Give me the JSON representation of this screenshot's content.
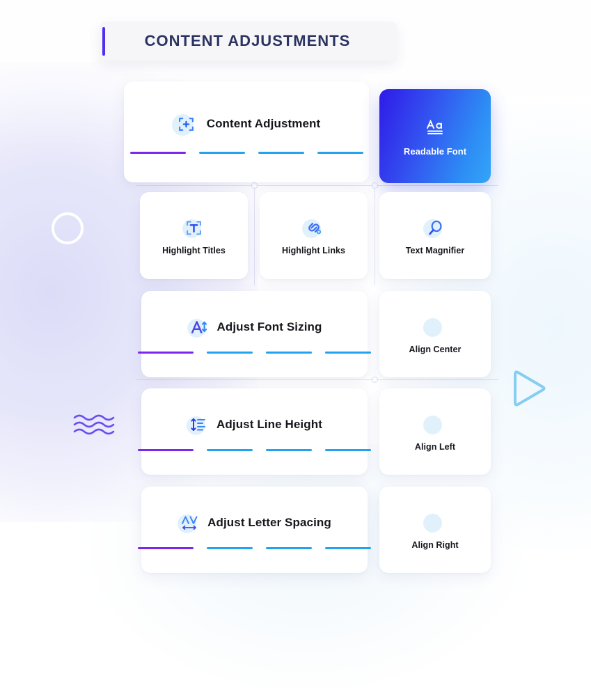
{
  "header": {
    "title": "CONTENT ADJUSTMENTS",
    "accent_color": "#4f2ef0",
    "background_color": "#f6f6f8"
  },
  "theme": {
    "accent_purple": "#7b27ee",
    "accent_blue": "#21a3ef",
    "active_gradient_from": "#2f1ae8",
    "active_gradient_to": "#34a5f8",
    "text_color": "#16161c",
    "title_color": "#2b3360",
    "card_background": "#ffffff",
    "page_background": "#ffffff",
    "lavender_glow": "#e6e6fa"
  },
  "panels": {
    "content_adjustment": {
      "label": "Content  Adjustment",
      "icon": "focus-frame-plus-icon",
      "bars": [
        {
          "state": "active",
          "color": "#7b27ee"
        },
        {
          "state": "inactive",
          "color": "#21a3ef"
        },
        {
          "state": "inactive",
          "color": "#21a3ef"
        },
        {
          "state": "inactive",
          "color": "#21a3ef"
        }
      ]
    },
    "readable_font": {
      "label": "Readable Font",
      "icon": "aa-underline-icon",
      "selected": true
    },
    "highlight_titles": {
      "label": "Highlight Titles",
      "icon": "text-frame-t-icon"
    },
    "highlight_links": {
      "label": "Highlight Links",
      "icon": "chain-link-icon"
    },
    "text_magnifier": {
      "label": "Text Magnifier",
      "icon": "magnifier-icon"
    },
    "adjust_font_sizing": {
      "label": "Adjust Font Sizing",
      "icon": "font-size-arrow-icon",
      "bars": [
        {
          "state": "active",
          "color": "#7b27ee"
        },
        {
          "state": "inactive",
          "color": "#21a3ef"
        },
        {
          "state": "inactive",
          "color": "#21a3ef"
        },
        {
          "state": "inactive",
          "color": "#21a3ef"
        }
      ]
    },
    "align_center": {
      "label": "Align Center",
      "icon": "align-center-icon"
    },
    "adjust_line_height": {
      "label": "Adjust Line Height",
      "icon": "line-height-arrow-icon",
      "bars": [
        {
          "state": "active",
          "color": "#7b27ee"
        },
        {
          "state": "inactive",
          "color": "#21a3ef"
        },
        {
          "state": "inactive",
          "color": "#21a3ef"
        },
        {
          "state": "inactive",
          "color": "#21a3ef"
        }
      ]
    },
    "align_left": {
      "label": "Align Left",
      "icon": "align-left-icon"
    },
    "adjust_letter_spacing": {
      "label": "Adjust Letter Spacing",
      "icon": "letter-spacing-arrow-icon",
      "bars": [
        {
          "state": "active",
          "color": "#7b27ee"
        },
        {
          "state": "inactive",
          "color": "#21a3ef"
        },
        {
          "state": "inactive",
          "color": "#21a3ef"
        },
        {
          "state": "inactive",
          "color": "#21a3ef"
        }
      ]
    },
    "align_right": {
      "label": "Align Right",
      "icon": "align-right-icon"
    }
  },
  "decorations": {
    "ring": {
      "icon": "circle-outline-decoration",
      "color": "#ffffff"
    },
    "waves": {
      "icon": "wavy-lines-decoration",
      "color": "#6a4df0"
    },
    "triangle": {
      "icon": "play-triangle-decoration",
      "color": "#87cdf2"
    }
  }
}
